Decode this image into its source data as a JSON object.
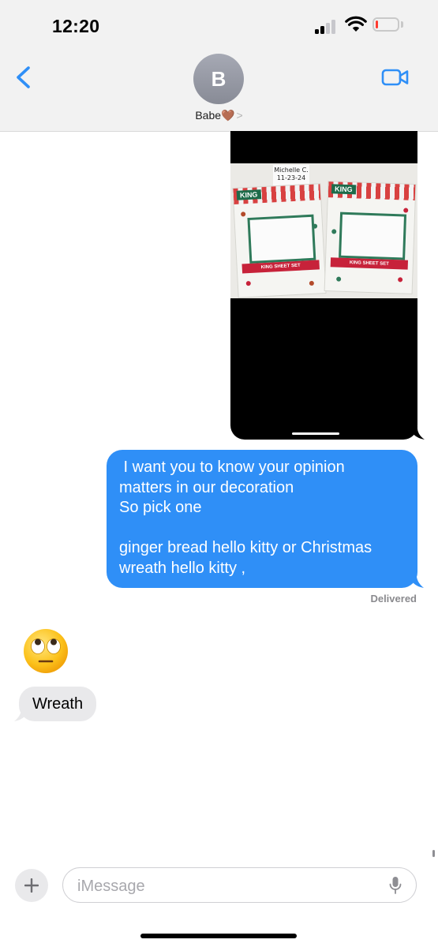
{
  "status_bar": {
    "time": "12:20",
    "signal_bars_active": 2,
    "signal_bars_total": 4,
    "battery_level": 0.1,
    "battery_color": "#ff3b30"
  },
  "header": {
    "back_icon": "chevron-left-icon",
    "avatar_initial": "B",
    "contact_name": "Babe",
    "contact_name_emoji": "🤎",
    "contact_chevron": ">",
    "video_call_icon": "video-camera-icon",
    "accent_color": "#2f8ff7"
  },
  "thread": {
    "image_message": {
      "note_text": "Michelle C. 11-23-24",
      "package_label": "KING",
      "package_subtitle": "KING SHEET SET"
    },
    "outgoing_message": {
      "lines": [
        " I want you to know your opinion",
        "matters in our decoration",
        "So pick one",
        "",
        "ginger bread hello kitty or Christmas",
        "wreath hello kitty ,"
      ],
      "bubble_color": "#2f8ff7"
    },
    "delivery_status": "Delivered",
    "incoming_reaction_emoji": "face-with-rolling-eyes",
    "incoming_message": "Wreath"
  },
  "composer": {
    "plus_icon": "plus-icon",
    "placeholder": "iMessage",
    "value": "",
    "mic_icon": "microphone-icon"
  }
}
